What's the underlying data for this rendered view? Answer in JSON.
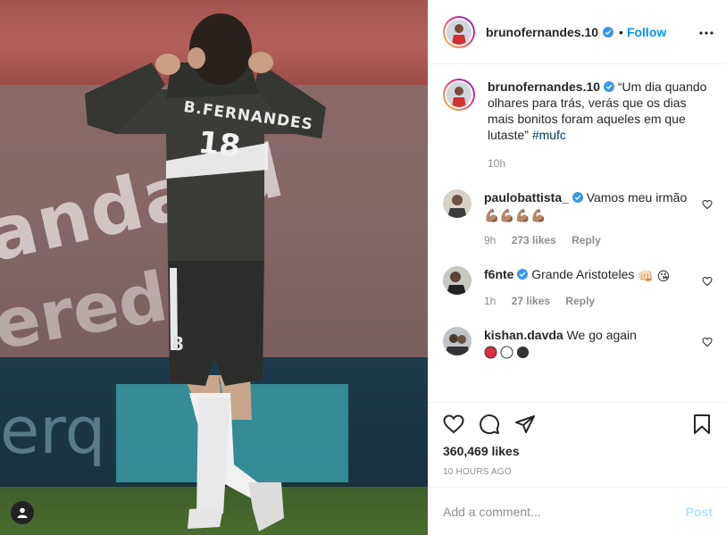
{
  "post": {
    "username": "brunofernandes.10",
    "follow_label": "Follow",
    "separator": "•",
    "caption": "“Um dia quando olhares para trás, verás que os dias mais bonitos foram aqueles em que lutaste”",
    "hashtag": "#mufc",
    "caption_time": "10h",
    "likes": "360,469 likes",
    "time_ago": "10 HOURS AGO"
  },
  "photo": {
    "jersey_name": "B.FERNANDES",
    "jersey_number": "18",
    "board_text": "andard",
    "board_text2": "ered S",
    "led_text": "erq"
  },
  "comments": [
    {
      "username": "paulobattista_",
      "verified": true,
      "text": "Vamos meu irmão",
      "emoji": "💪🏽💪🏽💪🏽💪🏽",
      "time": "9h",
      "likes": "273 likes",
      "reply": "Reply"
    },
    {
      "username": "f6nte",
      "verified": true,
      "text": "Grande Aristoteles",
      "emoji": "👊🏻",
      "emoji2": "😘",
      "time": "1h",
      "likes": "27 likes",
      "reply": "Reply"
    },
    {
      "username": "kishan.davda",
      "verified": false,
      "text": "We go again",
      "emoji": ""
    }
  ],
  "add_comment": {
    "placeholder": "Add a comment...",
    "post_label": "Post"
  },
  "colors": {
    "accent": "#0095f6",
    "link": "#00376b",
    "muted": "#8e8e8e",
    "post_disabled": "#b2dffc"
  }
}
